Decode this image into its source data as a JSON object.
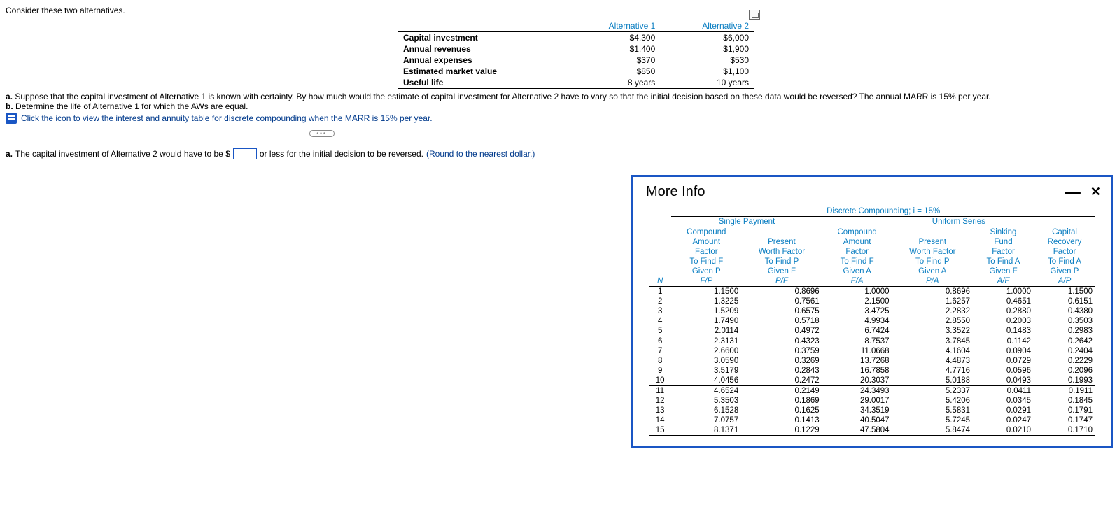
{
  "intro": "Consider these two alternatives.",
  "alt_table": {
    "headers": [
      "",
      "Alternative 1",
      "Alternative 2"
    ],
    "rows": [
      {
        "label": "Capital investment",
        "a1": "$4,300",
        "a2": "$6,000"
      },
      {
        "label": "Annual revenues",
        "a1": "$1,400",
        "a2": "$1,900"
      },
      {
        "label": "Annual expenses",
        "a1": "$370",
        "a2": "$530"
      },
      {
        "label": "Estimated market value",
        "a1": "$850",
        "a2": "$1,100"
      },
      {
        "label": "Useful life",
        "a1": "8 years",
        "a2": "10 years"
      }
    ]
  },
  "q_a_prefix": "a.",
  "q_a": "Suppose that the capital investment of Alternative 1 is known with certainty. By how much would the estimate of capital investment for Alternative 2 have to vary so that the initial decision based on these data would be reversed? The annual MARR is 15% per year.",
  "q_b_prefix": "b.",
  "q_b": "Determine the life of Alternative 1 for which the AWs are equal.",
  "link_text": "Click the icon to view the interest and annuity table for discrete compounding when the MARR is 15% per year.",
  "answer": {
    "prefix": "a.",
    "part1": "The capital investment of Alternative 2 would have to be $",
    "part2": "or less for the initial decision to be reversed.",
    "hint": "(Round to the nearest dollar.)"
  },
  "more_info": {
    "title": "More Info",
    "caption": "Discrete Compounding; i = 15%",
    "group1": "Single Payment",
    "group2": "Uniform Series",
    "cols": [
      {
        "h1": "Compound",
        "h2": "Amount",
        "h3": "Factor",
        "f1": "To Find F",
        "f2": "Given P",
        "f3": "F/P"
      },
      {
        "h1": "",
        "h2": "Present",
        "h3": "Worth Factor",
        "f1": "To Find P",
        "f2": "Given F",
        "f3": "P/F"
      },
      {
        "h1": "Compound",
        "h2": "Amount",
        "h3": "Factor",
        "f1": "To Find F",
        "f2": "Given A",
        "f3": "F/A"
      },
      {
        "h1": "",
        "h2": "Present",
        "h3": "Worth Factor",
        "f1": "To Find P",
        "f2": "Given A",
        "f3": "P/A"
      },
      {
        "h1": "Sinking",
        "h2": "Fund",
        "h3": "Factor",
        "f1": "To Find A",
        "f2": "Given F",
        "f3": "A/F"
      },
      {
        "h1": "Capital",
        "h2": "Recovery",
        "h3": "Factor",
        "f1": "To Find A",
        "f2": "Given P",
        "f3": "A/P"
      }
    ],
    "n_label": "N",
    "rows": [
      [
        1,
        "1.1500",
        "0.8696",
        "1.0000",
        "0.8696",
        "1.0000",
        "1.1500"
      ],
      [
        2,
        "1.3225",
        "0.7561",
        "2.1500",
        "1.6257",
        "0.4651",
        "0.6151"
      ],
      [
        3,
        "1.5209",
        "0.6575",
        "3.4725",
        "2.2832",
        "0.2880",
        "0.4380"
      ],
      [
        4,
        "1.7490",
        "0.5718",
        "4.9934",
        "2.8550",
        "0.2003",
        "0.3503"
      ],
      [
        5,
        "2.0114",
        "0.4972",
        "6.7424",
        "3.3522",
        "0.1483",
        "0.2983"
      ],
      [
        6,
        "2.3131",
        "0.4323",
        "8.7537",
        "3.7845",
        "0.1142",
        "0.2642"
      ],
      [
        7,
        "2.6600",
        "0.3759",
        "11.0668",
        "4.1604",
        "0.0904",
        "0.2404"
      ],
      [
        8,
        "3.0590",
        "0.3269",
        "13.7268",
        "4.4873",
        "0.0729",
        "0.2229"
      ],
      [
        9,
        "3.5179",
        "0.2843",
        "16.7858",
        "4.7716",
        "0.0596",
        "0.2096"
      ],
      [
        10,
        "4.0456",
        "0.2472",
        "20.3037",
        "5.0188",
        "0.0493",
        "0.1993"
      ],
      [
        11,
        "4.6524",
        "0.2149",
        "24.3493",
        "5.2337",
        "0.0411",
        "0.1911"
      ],
      [
        12,
        "5.3503",
        "0.1869",
        "29.0017",
        "5.4206",
        "0.0345",
        "0.1845"
      ],
      [
        13,
        "6.1528",
        "0.1625",
        "34.3519",
        "5.5831",
        "0.0291",
        "0.1791"
      ],
      [
        14,
        "7.0757",
        "0.1413",
        "40.5047",
        "5.7245",
        "0.0247",
        "0.1747"
      ],
      [
        15,
        "8.1371",
        "0.1229",
        "47.5804",
        "5.8474",
        "0.0210",
        "0.1710"
      ]
    ]
  },
  "chart_data": {
    "type": "table",
    "title": "Discrete Compounding; i = 15%",
    "columns": [
      "N",
      "F/P",
      "P/F",
      "F/A",
      "P/A",
      "A/F",
      "A/P"
    ],
    "rows": [
      [
        1,
        1.15,
        0.8696,
        1.0,
        0.8696,
        1.0,
        1.15
      ],
      [
        2,
        1.3225,
        0.7561,
        2.15,
        1.6257,
        0.4651,
        0.6151
      ],
      [
        3,
        1.5209,
        0.6575,
        3.4725,
        2.2832,
        0.288,
        0.438
      ],
      [
        4,
        1.749,
        0.5718,
        4.9934,
        2.855,
        0.2003,
        0.3503
      ],
      [
        5,
        2.0114,
        0.4972,
        6.7424,
        3.3522,
        0.1483,
        0.2983
      ],
      [
        6,
        2.3131,
        0.4323,
        8.7537,
        3.7845,
        0.1142,
        0.2642
      ],
      [
        7,
        2.66,
        0.3759,
        11.0668,
        4.1604,
        0.0904,
        0.2404
      ],
      [
        8,
        3.059,
        0.3269,
        13.7268,
        4.4873,
        0.0729,
        0.2229
      ],
      [
        9,
        3.5179,
        0.2843,
        16.7858,
        4.7716,
        0.0596,
        0.2096
      ],
      [
        10,
        4.0456,
        0.2472,
        20.3037,
        5.0188,
        0.0493,
        0.1993
      ],
      [
        11,
        4.6524,
        0.2149,
        24.3493,
        5.2337,
        0.0411,
        0.1911
      ],
      [
        12,
        5.3503,
        0.1869,
        29.0017,
        5.4206,
        0.0345,
        0.1845
      ],
      [
        13,
        6.1528,
        0.1625,
        34.3519,
        5.5831,
        0.0291,
        0.1791
      ],
      [
        14,
        7.0757,
        0.1413,
        40.5047,
        5.7245,
        0.0247,
        0.1747
      ],
      [
        15,
        8.1371,
        0.1229,
        47.5804,
        5.8474,
        0.021,
        0.171
      ]
    ]
  }
}
